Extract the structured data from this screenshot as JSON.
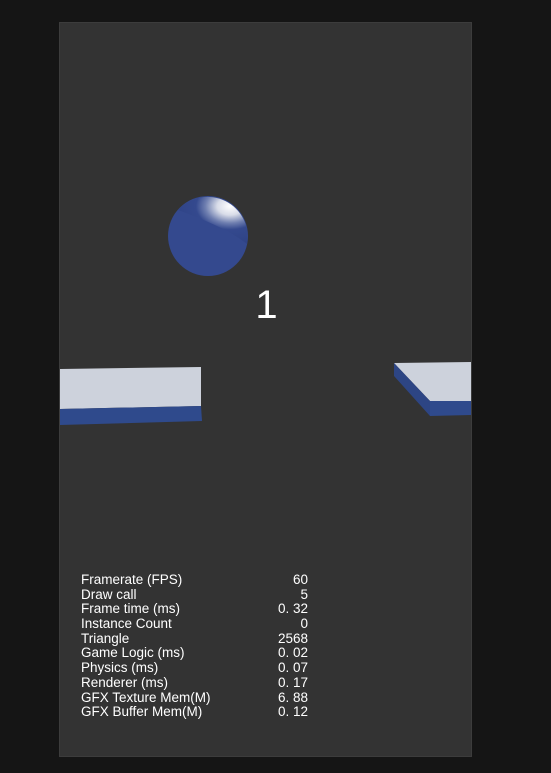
{
  "colors": {
    "page_background": "#151515",
    "viewport_background": "#333333",
    "ball": "#34498e",
    "platform_top": "#cdd2dc",
    "platform_side": "#2f4a8c",
    "text": "#ffffff"
  },
  "hud": {
    "score": "1"
  },
  "stats": [
    {
      "label": "Framerate (FPS)",
      "value": "60"
    },
    {
      "label": "Draw call",
      "value": "5"
    },
    {
      "label": "Frame time (ms)",
      "value": "0. 32"
    },
    {
      "label": "Instance Count",
      "value": "0"
    },
    {
      "label": "Triangle",
      "value": "2568"
    },
    {
      "label": "Game Logic (ms)",
      "value": "0. 02"
    },
    {
      "label": "Physics (ms)",
      "value": "0. 07"
    },
    {
      "label": "Renderer (ms)",
      "value": "0. 17"
    },
    {
      "label": "GFX Texture Mem(M)",
      "value": "6. 88"
    },
    {
      "label": "GFX Buffer Mem(M)",
      "value": "0. 12"
    }
  ]
}
